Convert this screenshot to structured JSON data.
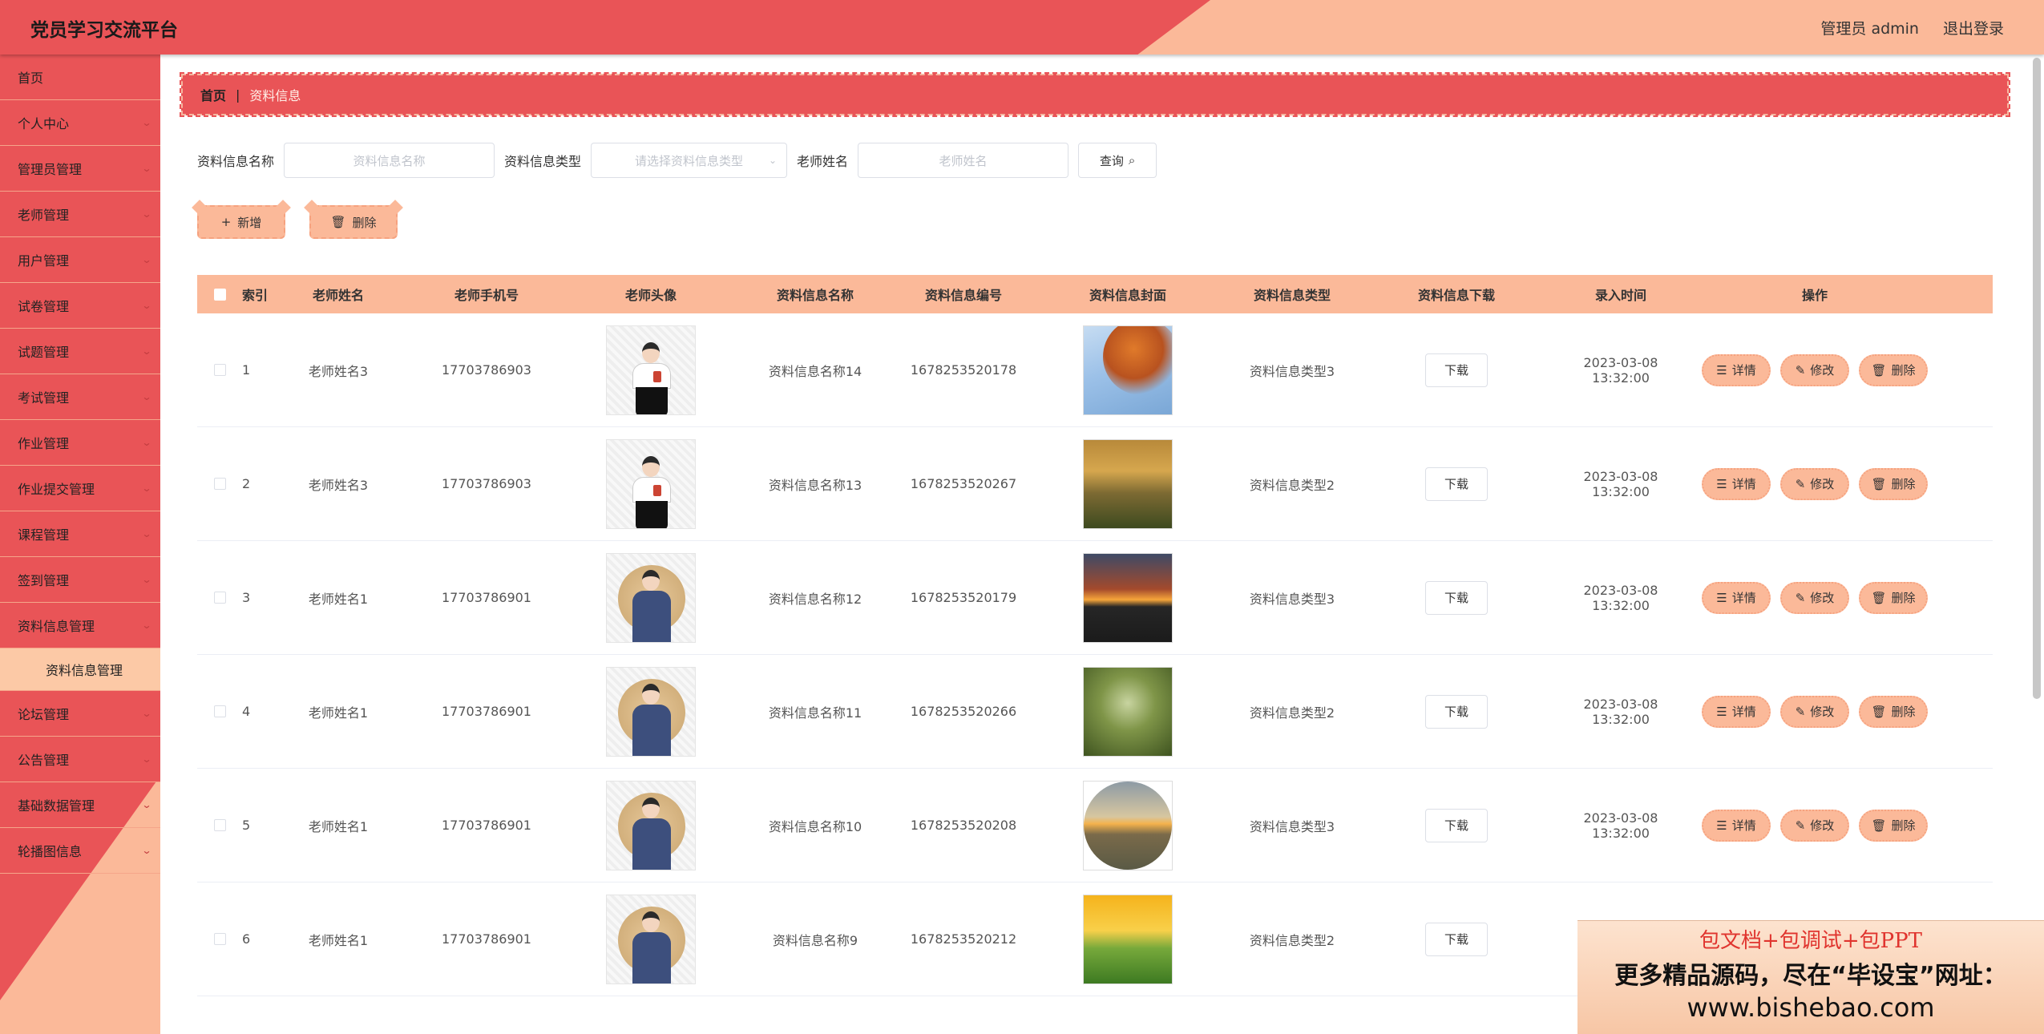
{
  "header": {
    "title": "党员学习交流平台",
    "user": "管理员 admin",
    "logout": "退出登录"
  },
  "sidebar": {
    "items": [
      {
        "label": "首页",
        "arrow": false
      },
      {
        "label": "个人中心",
        "arrow": true
      },
      {
        "label": "管理员管理",
        "arrow": true
      },
      {
        "label": "老师管理",
        "arrow": true
      },
      {
        "label": "用户管理",
        "arrow": true
      },
      {
        "label": "试卷管理",
        "arrow": true
      },
      {
        "label": "试题管理",
        "arrow": true
      },
      {
        "label": "考试管理",
        "arrow": true
      },
      {
        "label": "作业管理",
        "arrow": true
      },
      {
        "label": "作业提交管理",
        "arrow": true
      },
      {
        "label": "课程管理",
        "arrow": true
      },
      {
        "label": "签到管理",
        "arrow": true
      },
      {
        "label": "资料信息管理",
        "arrow": true
      },
      {
        "label": "资料信息管理",
        "sub": true
      },
      {
        "label": "论坛管理",
        "arrow": true
      },
      {
        "label": "公告管理",
        "arrow": true
      },
      {
        "label": "基础数据管理",
        "arrow": true
      },
      {
        "label": "轮播图信息",
        "arrow": true
      }
    ]
  },
  "breadcrumb": {
    "home": "首页",
    "sep": "|",
    "current": "资料信息"
  },
  "search": {
    "name_label": "资料信息名称",
    "name_placeholder": "资料信息名称",
    "type_label": "资料信息类型",
    "type_placeholder": "请选择资料信息类型",
    "teacher_label": "老师姓名",
    "teacher_placeholder": "老师姓名",
    "query": "查询"
  },
  "actions": {
    "add": "新增",
    "delete": "删除"
  },
  "table": {
    "headers": [
      "索引",
      "老师姓名",
      "老师手机号",
      "老师头像",
      "资料信息名称",
      "资料信息编号",
      "资料信息封面",
      "资料信息类型",
      "资料信息下载",
      "录入时间",
      "操作"
    ],
    "download_label": "下载",
    "op_detail": "详情",
    "op_edit": "修改",
    "op_delete": "删除",
    "rows": [
      {
        "idx": "1",
        "name": "老师姓名3",
        "phone": "17703786903",
        "title": "资料信息名称14",
        "code": "1678253520178",
        "type": "资料信息类型3",
        "time": "2023-03-08 13:32:00"
      },
      {
        "idx": "2",
        "name": "老师姓名3",
        "phone": "17703786903",
        "title": "资料信息名称13",
        "code": "1678253520267",
        "type": "资料信息类型2",
        "time": "2023-03-08 13:32:00"
      },
      {
        "idx": "3",
        "name": "老师姓名1",
        "phone": "17703786901",
        "title": "资料信息名称12",
        "code": "1678253520179",
        "type": "资料信息类型3",
        "time": "2023-03-08 13:32:00"
      },
      {
        "idx": "4",
        "name": "老师姓名1",
        "phone": "17703786901",
        "title": "资料信息名称11",
        "code": "1678253520266",
        "type": "资料信息类型2",
        "time": "2023-03-08 13:32:00"
      },
      {
        "idx": "5",
        "name": "老师姓名1",
        "phone": "17703786901",
        "title": "资料信息名称10",
        "code": "1678253520208",
        "type": "资料信息类型3",
        "time": "2023-03-08 13:32:00"
      },
      {
        "idx": "6",
        "name": "老师姓名1",
        "phone": "17703786901",
        "title": "资料信息名称9",
        "code": "1678253520212",
        "type": "资料信息类型2",
        "time": ""
      }
    ]
  },
  "watermark": {
    "line1": "包文档+包调试+包PPT",
    "line2": "更多精品源码，尽在“毕设宝”网址：",
    "line3": "www.bishebao.com"
  }
}
